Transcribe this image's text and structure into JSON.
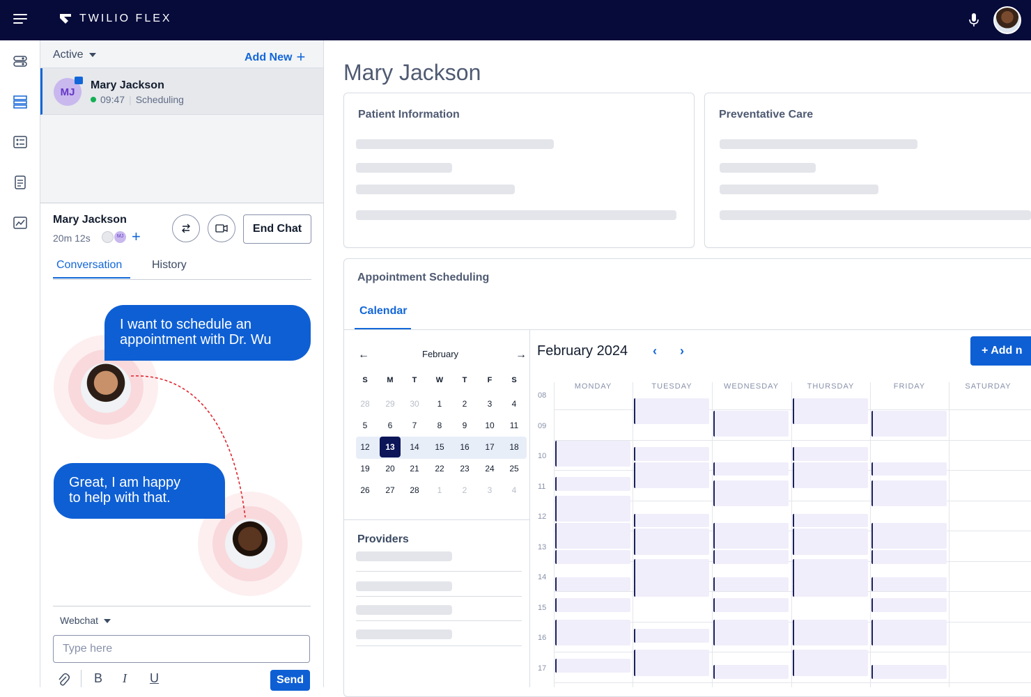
{
  "app": {
    "brand": "TWILIO FLEX"
  },
  "tasklist": {
    "filter": "Active",
    "add_new": "Add New"
  },
  "task": {
    "initials": "MJ",
    "name": "Mary Jackson",
    "timer": "09:47",
    "queue": "Scheduling"
  },
  "chat": {
    "customer": "Mary Jackson",
    "duration": "20m 12s",
    "participant_initials": "MJ",
    "end_chat": "End Chat",
    "tabs": [
      "Conversation",
      "History"
    ],
    "messages": [
      {
        "line1": "I want to schedule an",
        "line2": "appointment with Dr. Wu"
      },
      {
        "line1": "Great, I am happy",
        "line2": "to help with that."
      }
    ],
    "channel": "Webchat",
    "input_placeholder": "Type here",
    "send": "Send",
    "format": {
      "bold": "B",
      "italic": "I",
      "underline": "U"
    }
  },
  "main": {
    "title": "Mary Jackson",
    "patient_info": "Patient Information",
    "preventative_care": "Preventative Care",
    "appointment": "Appointment Scheduling",
    "calendar_tab": "Calendar",
    "providers": "Providers"
  },
  "mini_calendar": {
    "month": "February",
    "weekdays": [
      "S",
      "M",
      "T",
      "W",
      "T",
      "F",
      "S"
    ],
    "weeks": [
      [
        "28",
        "29",
        "30",
        "1",
        "2",
        "3",
        "4"
      ],
      [
        "5",
        "6",
        "7",
        "8",
        "9",
        "10",
        "11"
      ],
      [
        "12",
        "13",
        "14",
        "15",
        "16",
        "17",
        "18"
      ],
      [
        "19",
        "20",
        "21",
        "22",
        "23",
        "24",
        "25"
      ],
      [
        "26",
        "27",
        "28",
        "1",
        "2",
        "3",
        "4"
      ]
    ],
    "selected": "13"
  },
  "week_view": {
    "title": "February 2024",
    "add_button": "Add n",
    "days": [
      "MONDAY",
      "TUESDAY",
      "WEDNESDAY",
      "THURSDAY",
      "FRIDAY",
      "SATURDAY"
    ],
    "hours": [
      "08",
      "09",
      "10",
      "11",
      "12",
      "13",
      "14",
      "15",
      "16",
      "17"
    ]
  },
  "colors": {
    "topbar": "#060b3a",
    "accent": "#0e5fd4",
    "selected_day": "#0b1558",
    "event": "#f1eefb"
  }
}
